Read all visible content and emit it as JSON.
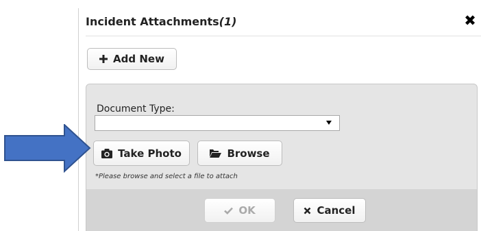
{
  "background": {
    "cutoff_text": ""
  },
  "dialog": {
    "title": "Incident Attachments",
    "count": "(1)",
    "close_glyph": "✖",
    "add_new_label": "Add New",
    "add_new_icon": "plus-icon",
    "document_type_label": "Document Type:",
    "document_type_value": "",
    "take_photo_label": "Take Photo",
    "take_photo_icon": "camera-icon",
    "browse_label": "Browse",
    "browse_icon": "folder-open-icon",
    "hint": "*Please browse and select a file to attach",
    "ok_label": "OK",
    "ok_icon": "check-icon",
    "cancel_label": "Cancel",
    "cancel_icon": "times-icon"
  },
  "annotation": {
    "arrow_color": "#4472C4",
    "arrow_stroke": "#2F528F"
  }
}
